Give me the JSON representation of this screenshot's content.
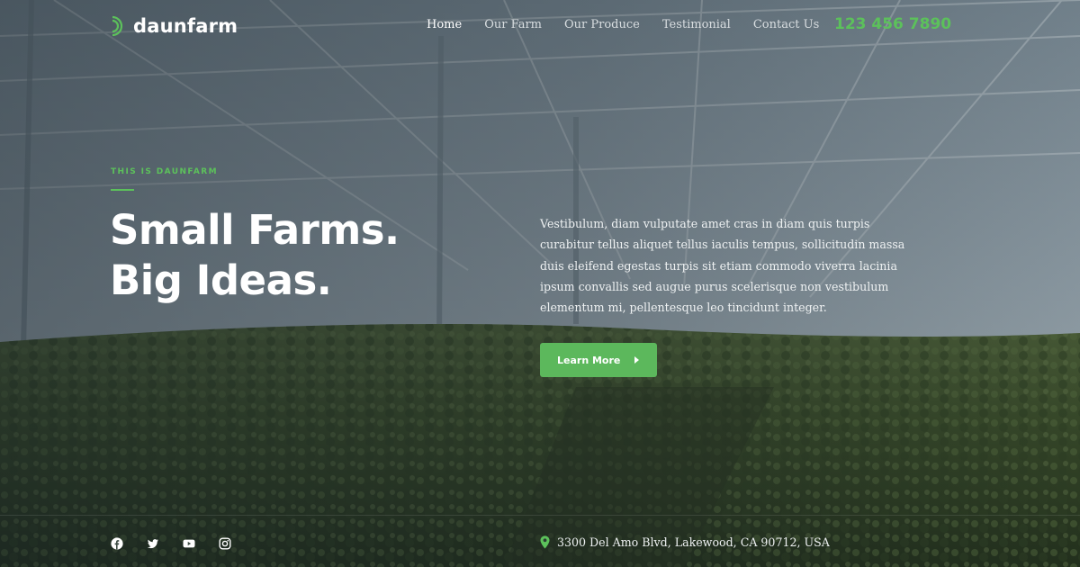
{
  "brand": {
    "name": "daunfarm",
    "logo_icon": "signal-arcs-icon"
  },
  "nav": {
    "items": [
      {
        "label": "Home",
        "active": true
      },
      {
        "label": "Our Farm",
        "active": false
      },
      {
        "label": "Our Produce",
        "active": false
      },
      {
        "label": "Testimonial",
        "active": false
      },
      {
        "label": "Contact Us",
        "active": false
      }
    ]
  },
  "header": {
    "phone": "123 456 7890"
  },
  "hero": {
    "eyebrow": "THIS IS DAUNFARM",
    "headline_line1": "Small Farms.",
    "headline_line2": "Big Ideas.",
    "lead": "Vestibulum, diam vulputate amet cras in diam quis turpis curabitur tellus aliquet tellus iaculis tempus, sollicitudin massa duis eleifend egestas turpis sit etiam commodo viverra lacinia ipsum convallis sed augue purus scelerisque non vestibulum elementum mi, pellentesque leo tincidunt integer.",
    "cta_label": "Learn More",
    "cta_icon": "caret-right-icon"
  },
  "footer": {
    "socials": [
      "facebook-icon",
      "twitter-icon",
      "youtube-icon",
      "instagram-icon"
    ],
    "address_icon": "map-pin-icon",
    "address": "3300 Del Amo Blvd, Lakewood, CA 90712, USA"
  },
  "colors": {
    "accent": "#5cc15b",
    "button": "#5cb85c",
    "text": "#ffffff"
  }
}
